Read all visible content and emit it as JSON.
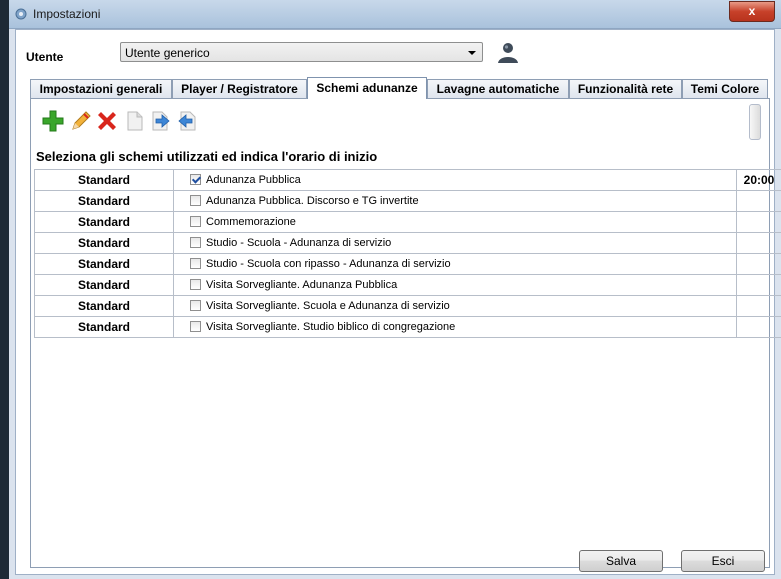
{
  "window": {
    "title": "Impostazioni",
    "close_label": "x"
  },
  "user": {
    "label": "Utente",
    "selected": "Utente generico"
  },
  "tabs": [
    {
      "label": "Impostazioni generali",
      "active": false
    },
    {
      "label": "Player / Registratore",
      "active": false
    },
    {
      "label": "Schemi adunanze",
      "active": true
    },
    {
      "label": "Lavagne automatiche",
      "active": false
    },
    {
      "label": "Funzionalità rete",
      "active": false
    },
    {
      "label": "Temi Colore",
      "active": false
    }
  ],
  "toolbar": {
    "icons": [
      "add-icon",
      "edit-pencil-icon",
      "delete-icon",
      "copy-document-icon",
      "move-right-icon",
      "move-left-icon"
    ]
  },
  "section_title": "Seleziona gli schemi utilizzati ed indica l'orario di inizio",
  "rows": [
    {
      "type": "Standard",
      "name": "Adunanza Pubblica",
      "checked": true,
      "time": "20:00"
    },
    {
      "type": "Standard",
      "name": "Adunanza Pubblica. Discorso e TG invertite",
      "checked": false,
      "time": ""
    },
    {
      "type": "Standard",
      "name": "Commemorazione",
      "checked": false,
      "time": ""
    },
    {
      "type": "Standard",
      "name": "Studio - Scuola - Adunanza di servizio",
      "checked": false,
      "time": ""
    },
    {
      "type": "Standard",
      "name": "Studio - Scuola con ripasso - Adunanza di servizio",
      "checked": false,
      "time": ""
    },
    {
      "type": "Standard",
      "name": "Visita Sorvegliante. Adunanza Pubblica",
      "checked": false,
      "time": ""
    },
    {
      "type": "Standard",
      "name": "Visita Sorvegliante. Scuola e Adunanza di servizio",
      "checked": false,
      "time": ""
    },
    {
      "type": "Standard",
      "name": "Visita Sorvegliante. Studio biblico di congregazione",
      "checked": false,
      "time": ""
    }
  ],
  "buttons": {
    "save": "Salva",
    "exit": "Esci"
  },
  "colors": {
    "titlebar": "#a9c2dc",
    "close": "#c7412a",
    "accent_green": "#3aa62b",
    "delete_red": "#d9261c"
  }
}
